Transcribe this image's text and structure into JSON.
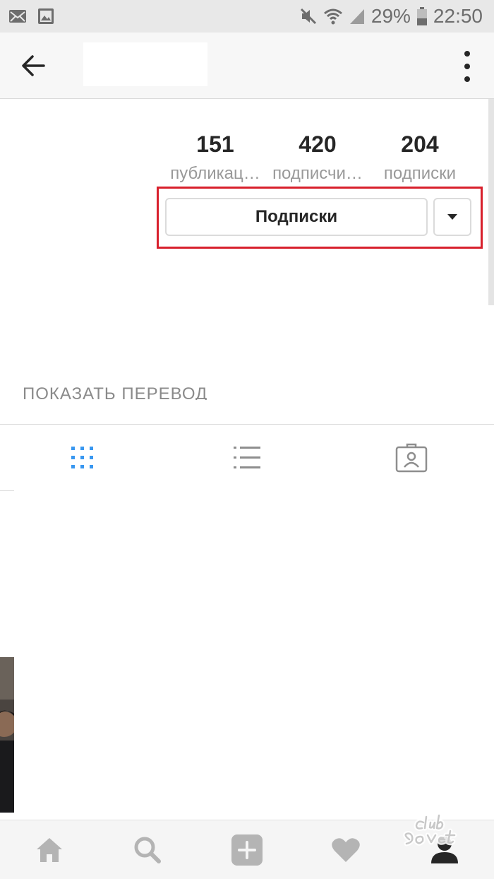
{
  "status_bar": {
    "battery": "29%",
    "time": "22:50",
    "icons": [
      "mail-icon",
      "image-icon",
      "mute-icon",
      "wifi-icon",
      "signal-icon",
      "battery-icon"
    ]
  },
  "toolbar": {
    "back_icon": "arrow-left-icon",
    "more_icon": "more-vertical-icon"
  },
  "profile": {
    "stats": [
      {
        "value": "151",
        "label": "публикац…"
      },
      {
        "value": "420",
        "label": "подписчи…"
      },
      {
        "value": "204",
        "label": "подписки"
      }
    ],
    "follow_button": "Подписки",
    "dropdown_icon": "caret-down-icon",
    "translate_link": "ПОКАЗАТЬ ПЕРЕВОД"
  },
  "tabs": [
    {
      "icon": "grid-icon",
      "active": true
    },
    {
      "icon": "list-icon",
      "active": false
    },
    {
      "icon": "tagged-icon",
      "active": false
    }
  ],
  "bottom_nav": [
    {
      "icon": "home-icon"
    },
    {
      "icon": "search-icon"
    },
    {
      "icon": "add-icon"
    },
    {
      "icon": "heart-icon"
    },
    {
      "icon": "profile-icon"
    }
  ],
  "watermark": "club Sovet",
  "colors": {
    "highlight": "#d8202c",
    "active_tab": "#3897f0",
    "text_dark": "#262626",
    "text_muted": "#999999"
  }
}
